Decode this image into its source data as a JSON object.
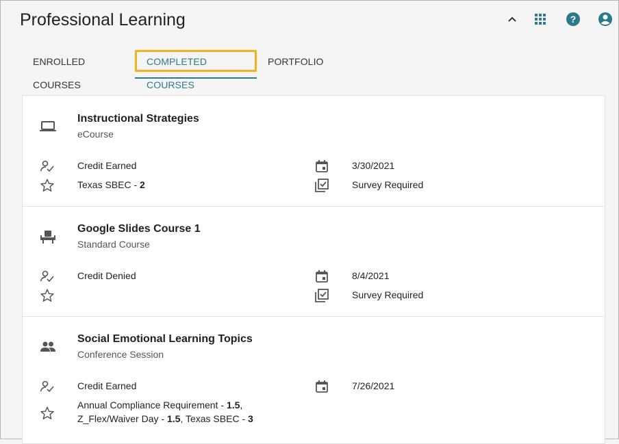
{
  "app_title": "Professional Learning",
  "header_icons": [
    "chevron-up-icon",
    "apps-grid-icon",
    "help-icon",
    "account-icon"
  ],
  "tabs": [
    {
      "label": "ENROLLED COURSES"
    },
    {
      "label": "COMPLETED COURSES",
      "active": true
    },
    {
      "label": "PORTFOLIO"
    }
  ],
  "courses": [
    {
      "name": "Instructional Strategies",
      "type": "eCourse",
      "type_icon": "laptop-icon",
      "credit_status": "Credit Earned",
      "date": "3/30/2021",
      "credits": [
        {
          "name": "Texas SBEC",
          "value": "2"
        }
      ],
      "survey": "Survey Required"
    },
    {
      "name": "Google Slides Course 1",
      "type": "Standard Course",
      "type_icon": "classroom-seat-icon",
      "credit_status": "Credit Denied",
      "date": "8/4/2021",
      "credits": [],
      "survey": "Survey Required"
    },
    {
      "name": "Social Emotional Learning Topics",
      "type": "Conference Session",
      "type_icon": "people-icon",
      "credit_status": "Credit Earned",
      "date": "7/26/2021",
      "credits": [
        {
          "name": "Annual Compliance Requirement",
          "value": "1.5"
        },
        {
          "name": "Z_Flex/Waiver Day",
          "value": "1.5"
        },
        {
          "name": "Texas SBEC",
          "value": "3"
        }
      ],
      "survey": ""
    }
  ],
  "colors": {
    "accent": "#2a7a8c",
    "focus_outline": "#f3b11b",
    "icon": "#2a7a8c"
  }
}
